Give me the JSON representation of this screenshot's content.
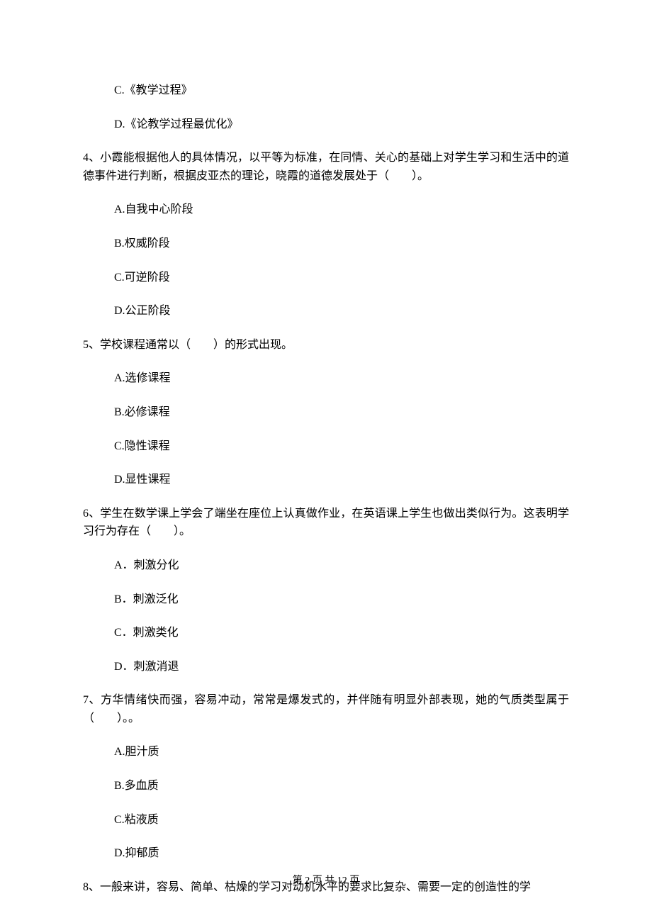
{
  "q3": {
    "optC": "C.《教学过程》",
    "optD": "D.《论教学过程最优化》"
  },
  "q4": {
    "text": "4、小霞能根据他人的具体情况，以平等为标准，在同情、关心的基础上对学生学习和生活中的道德事件进行判断，根据皮亚杰的理论，晓霞的道德发展处于（　　）。",
    "optA": "A.自我中心阶段",
    "optB": "B.权威阶段",
    "optC": "C.可逆阶段",
    "optD": "D.公正阶段"
  },
  "q5": {
    "text": "5、学校课程通常以（　　）的形式出现。",
    "optA": "A.选修课程",
    "optB": "B.必修课程",
    "optC": "C.隐性课程",
    "optD": "D.显性课程"
  },
  "q6": {
    "text": "6、学生在数学课上学会了端坐在座位上认真做作业，在英语课上学生也做出类似行为。这表明学习行为存在（　　）。",
    "optA": "A．刺激分化",
    "optB": "B．刺激泛化",
    "optC": "C．刺激类化",
    "optD": "D．刺激消退"
  },
  "q7": {
    "text": "7、方华情绪快而强，容易冲动，常常是爆发式的，并伴随有明显外部表现，她的气质类型属于（　　）。。",
    "optA": "A.胆汁质",
    "optB": "B.多血质",
    "optC": "C.粘液质",
    "optD": "D.抑郁质"
  },
  "q8": {
    "text": "8、一般来讲，容易、简单、枯燥的学习对动机水平的要求比复杂、需要一定的创造性的学"
  },
  "footer": "第 2 页 共 12 页"
}
